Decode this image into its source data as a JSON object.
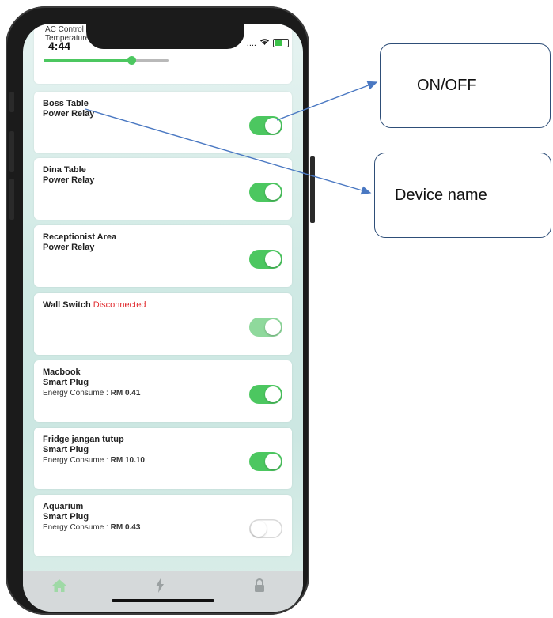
{
  "status_bar": {
    "time": "4:44",
    "signal": "....",
    "wifi": "wifi-icon"
  },
  "ac_card": {
    "title": "AC Control",
    "subtitle": "Temperature",
    "slider_level": 0.7
  },
  "devices": [
    {
      "name": "Boss Table",
      "type": "Power Relay",
      "state": "on"
    },
    {
      "name": "Dina Table",
      "type": "Power Relay",
      "state": "on"
    },
    {
      "name": "Receptionist Area",
      "type": "Power Relay",
      "state": "on"
    },
    {
      "name": "Wall Switch",
      "status": "Disconnected",
      "state": "on-dim"
    },
    {
      "name": "Macbook",
      "type": "Smart Plug",
      "energy_label": "Energy Consume : ",
      "energy_value": "RM 0.41",
      "state": "on"
    },
    {
      "name": "Fridge jangan tutup",
      "type": "Smart Plug",
      "energy_label": "Energy Consume : ",
      "energy_value": "RM 10.10",
      "state": "on"
    },
    {
      "name": "Aquarium",
      "type": "Smart Plug",
      "energy_label": "Energy Consume : ",
      "energy_value": "RM 0.43",
      "state": "off"
    }
  ],
  "tabs": [
    {
      "icon": "home-icon"
    },
    {
      "icon": "lightning-icon"
    },
    {
      "icon": "lock-icon"
    }
  ],
  "callouts": {
    "onoff": "ON/OFF",
    "device_name": "Device name"
  },
  "colors": {
    "toggle_on": "#4cc760",
    "disconnected": "#e0282c",
    "callout_border": "#2e4e78",
    "arrow": "#4a78c2"
  }
}
